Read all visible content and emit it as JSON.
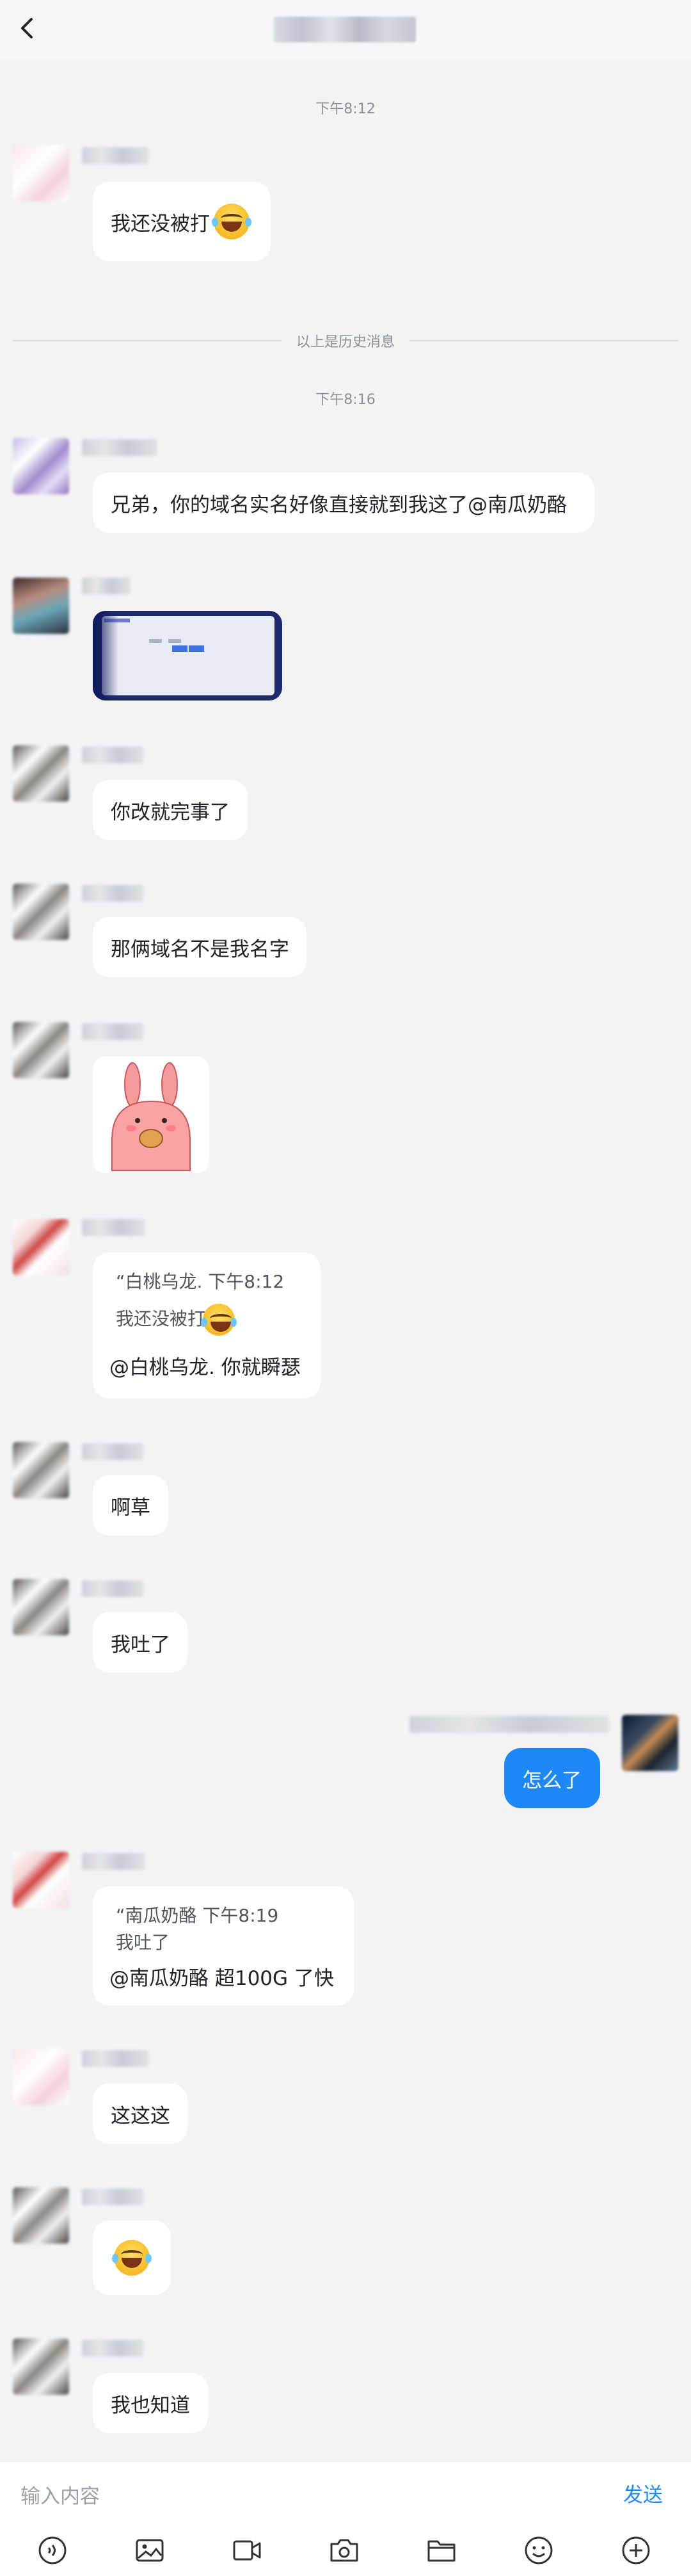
{
  "header": {
    "back_label": "back"
  },
  "messages": {
    "time1": "下午8:12",
    "msg1": "我还没被打",
    "divider": "以上是历史消息",
    "time2": "下午8:16",
    "msg2": "兄弟，你的域名实名好像直接就到我这了@南瓜奶酪",
    "msg4": "你改就完事了",
    "msg5": "那俩域名不是我名字",
    "reply1": {
      "quote_sender": "“白桃乌龙. 下午8:12",
      "quote_text": "我还没被打",
      "text": "@白桃乌龙. 你就瞬瑟"
    },
    "msg8": "啊草",
    "msg9": "我吐了",
    "msg10": "怎么了",
    "reply2": {
      "quote_sender": "“南瓜奶酪 下午8:19",
      "quote_text": "我吐了",
      "text": "@南瓜奶酪 超100G 了快"
    },
    "msg12": "这这这",
    "msg14": "我也知道"
  },
  "input": {
    "placeholder": "输入内容",
    "send_label": "发送"
  },
  "toolbar": {
    "icons": [
      "voice-icon",
      "image-icon",
      "video-icon",
      "camera-icon",
      "folder-icon",
      "emoji-icon",
      "plus-icon"
    ]
  },
  "colors": {
    "accent": "#1e88f7",
    "background": "#f2f3f5"
  }
}
